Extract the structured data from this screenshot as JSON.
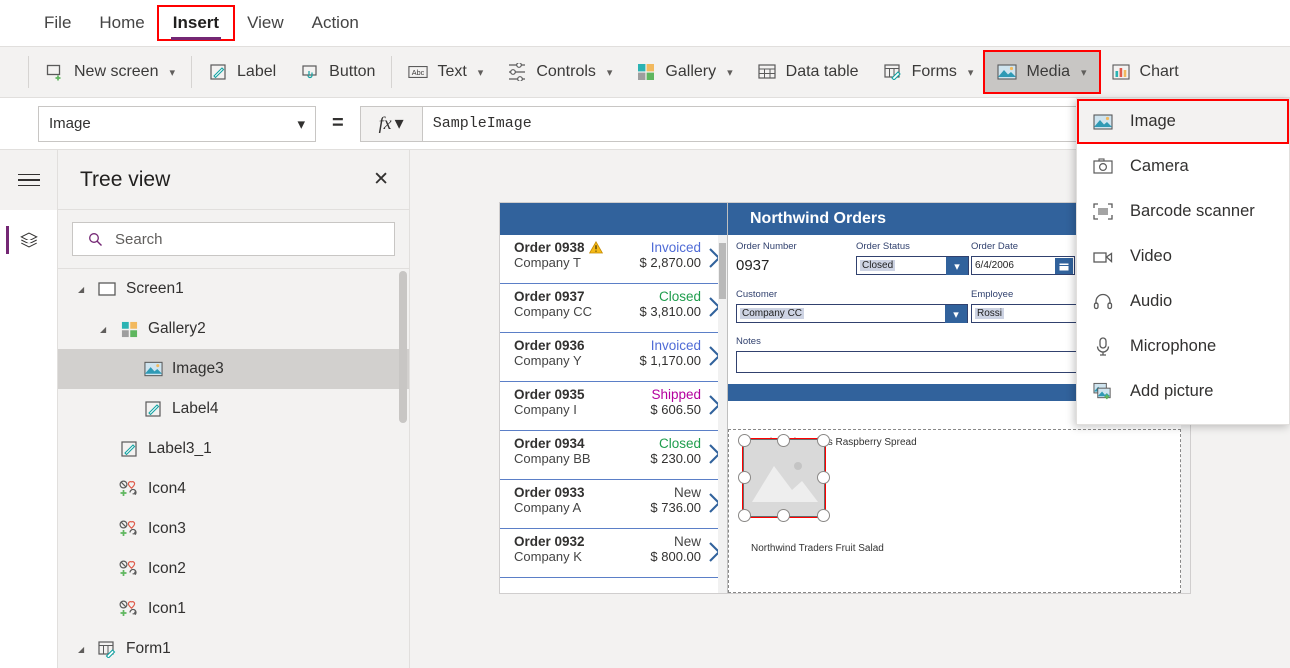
{
  "menubar": {
    "items": [
      {
        "label": "File",
        "active": false
      },
      {
        "label": "Home",
        "active": false
      },
      {
        "label": "Insert",
        "active": true
      },
      {
        "label": "View",
        "active": false
      },
      {
        "label": "Action",
        "active": false
      }
    ]
  },
  "ribbon": {
    "buttons": [
      {
        "label": "New screen",
        "icon": "new-screen-icon",
        "caret": true
      },
      {
        "label": "Label",
        "icon": "label-icon",
        "caret": false
      },
      {
        "label": "Button",
        "icon": "button-icon",
        "caret": false
      },
      {
        "label": "Text",
        "icon": "text-icon",
        "caret": true
      },
      {
        "label": "Controls",
        "icon": "controls-icon",
        "caret": true
      },
      {
        "label": "Gallery",
        "icon": "gallery-icon",
        "caret": true
      },
      {
        "label": "Data table",
        "icon": "data-table-icon",
        "caret": false
      },
      {
        "label": "Forms",
        "icon": "forms-icon",
        "caret": true
      },
      {
        "label": "Media",
        "icon": "media-icon",
        "caret": true
      },
      {
        "label": "Chart",
        "icon": "chart-icon",
        "caret": false
      }
    ]
  },
  "formula_bar": {
    "property": "Image",
    "equals": "=",
    "fx_label": "fx",
    "value": "SampleImage"
  },
  "tree_view": {
    "title": "Tree view",
    "close_label": "✕",
    "search_placeholder": "Search",
    "items": [
      {
        "label": "Screen1",
        "icon": "screen-icon",
        "indent": 0,
        "twist": "◢",
        "selected": false
      },
      {
        "label": "Gallery2",
        "icon": "gallery-icon",
        "indent": 1,
        "twist": "◢",
        "selected": false
      },
      {
        "label": "Image3",
        "icon": "image-icon",
        "indent": 2,
        "twist": "",
        "selected": true
      },
      {
        "label": "Label4",
        "icon": "label-icon",
        "indent": 2,
        "twist": "",
        "selected": false
      },
      {
        "label": "Label3_1",
        "icon": "label-icon",
        "indent": 1,
        "twist": "",
        "selected": false
      },
      {
        "label": "Icon4",
        "icon": "icon-glyph",
        "indent": 1,
        "twist": "",
        "selected": false
      },
      {
        "label": "Icon3",
        "icon": "icon-glyph",
        "indent": 1,
        "twist": "",
        "selected": false
      },
      {
        "label": "Icon2",
        "icon": "icon-glyph",
        "indent": 1,
        "twist": "",
        "selected": false
      },
      {
        "label": "Icon1",
        "icon": "icon-glyph",
        "indent": 1,
        "twist": "",
        "selected": false
      },
      {
        "label": "Form1",
        "icon": "form-icon",
        "indent": 0,
        "twist": "◢",
        "selected": false
      }
    ]
  },
  "media_menu": {
    "items": [
      {
        "label": "Image",
        "icon": "image-icon",
        "highlighted": true
      },
      {
        "label": "Camera",
        "icon": "camera-icon",
        "highlighted": false
      },
      {
        "label": "Barcode scanner",
        "icon": "barcode-icon",
        "highlighted": false
      },
      {
        "label": "Video",
        "icon": "video-icon",
        "highlighted": false
      },
      {
        "label": "Audio",
        "icon": "audio-icon",
        "highlighted": false
      },
      {
        "label": "Microphone",
        "icon": "microphone-icon",
        "highlighted": false
      },
      {
        "label": "Add picture",
        "icon": "add-picture-icon",
        "highlighted": false
      }
    ]
  },
  "canvas": {
    "gallery": {
      "orders": [
        {
          "order": "Order 0938",
          "company": "Company T",
          "status": "Invoiced",
          "status_color": "#4f6bd6",
          "amount": "$ 2,870.00",
          "warning": true
        },
        {
          "order": "Order 0937",
          "company": "Company CC",
          "status": "Closed",
          "status_color": "#1f9d4d",
          "amount": "$ 3,810.00",
          "warning": false
        },
        {
          "order": "Order 0936",
          "company": "Company Y",
          "status": "Invoiced",
          "status_color": "#4f6bd6",
          "amount": "$ 1,170.00",
          "warning": false
        },
        {
          "order": "Order 0935",
          "company": "Company I",
          "status": "Shipped",
          "status_color": "#b4009e",
          "amount": "$ 606.50",
          "warning": false
        },
        {
          "order": "Order 0934",
          "company": "Company BB",
          "status": "Closed",
          "status_color": "#1f9d4d",
          "amount": "$ 230.00",
          "warning": false
        },
        {
          "order": "Order 0933",
          "company": "Company A",
          "status": "New",
          "status_color": "#444444",
          "amount": "$ 736.00",
          "warning": false
        },
        {
          "order": "Order 0932",
          "company": "Company K",
          "status": "New",
          "status_color": "#444444",
          "amount": "$ 800.00",
          "warning": false
        }
      ]
    },
    "form": {
      "title": "Northwind Orders",
      "delete_icon": "trash-icon",
      "fields": {
        "order_number_label": "Order Number",
        "order_number_value": "0937",
        "order_status_label": "Order Status",
        "order_status_value": "Closed",
        "order_date_label": "Order Date",
        "order_date_value": "6/4/2006",
        "customer_label": "Customer",
        "customer_value": "Company CC",
        "employee_label": "Employee",
        "employee_value": "Rossi",
        "notes_label": "Notes",
        "notes_value": ""
      },
      "media_items": [
        {
          "label": "Northwind Traders Raspberry Spread"
        },
        {
          "label": "Northwind Traders Fruit Salad"
        }
      ]
    }
  },
  "colors": {
    "accent_purple": "#742774",
    "ribbon_bg": "#f3f2f1",
    "app_blue": "#31629c",
    "selection_red": "#ff0000",
    "tree_selected": "#d2d0ce"
  }
}
